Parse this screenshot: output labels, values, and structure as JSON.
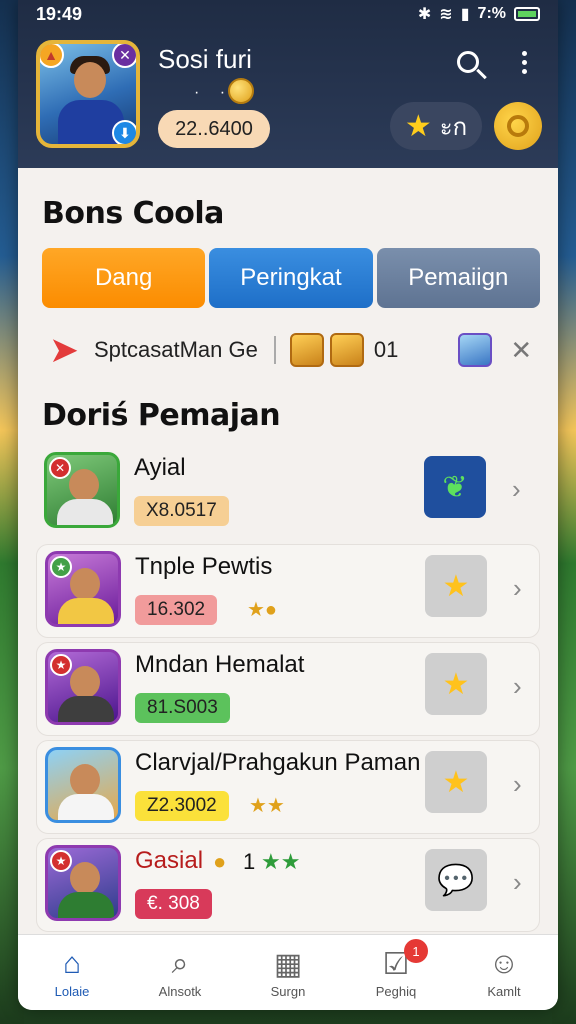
{
  "status_bar": {
    "time": "19:49",
    "battery": "7:%"
  },
  "header": {
    "profile_name": "Sosi furi",
    "dots": "· ·",
    "balance": "22..6400",
    "star_value": "ะก"
  },
  "section_1": {
    "title": "Bons Coola"
  },
  "tabs": [
    {
      "label": "Dang"
    },
    {
      "label": "Peringkat"
    },
    {
      "label": "Pemaiign"
    }
  ],
  "promo": {
    "text": "SptcasatMan Ge",
    "count": "01"
  },
  "section_2": {
    "title": "Doriś Pemajan"
  },
  "rows": [
    {
      "name": "Ayial",
      "value": "X8.0517"
    },
    {
      "name": "Tnple Pewtis",
      "value": "16.302"
    },
    {
      "name": "Mndan Hemalat",
      "value": "81.S003"
    },
    {
      "name": "Clarvjal/Prahgakun Paman",
      "value": "Z2.3002"
    },
    {
      "name": "Gasial",
      "value": "€. 308",
      "extra": "1"
    }
  ],
  "bottom_nav": [
    {
      "label": "Lolaie"
    },
    {
      "label": "Alnsotk"
    },
    {
      "label": "Surgn"
    },
    {
      "label": "Peghiq",
      "badge": "1"
    },
    {
      "label": "Kamlt"
    }
  ],
  "colors": {
    "header_bg": "#1f2c44",
    "tab_orange": "#fb8c00",
    "tab_blue": "#1e6fc8",
    "tab_gray": "#5e7392",
    "nav_active": "#1f5bb4"
  }
}
